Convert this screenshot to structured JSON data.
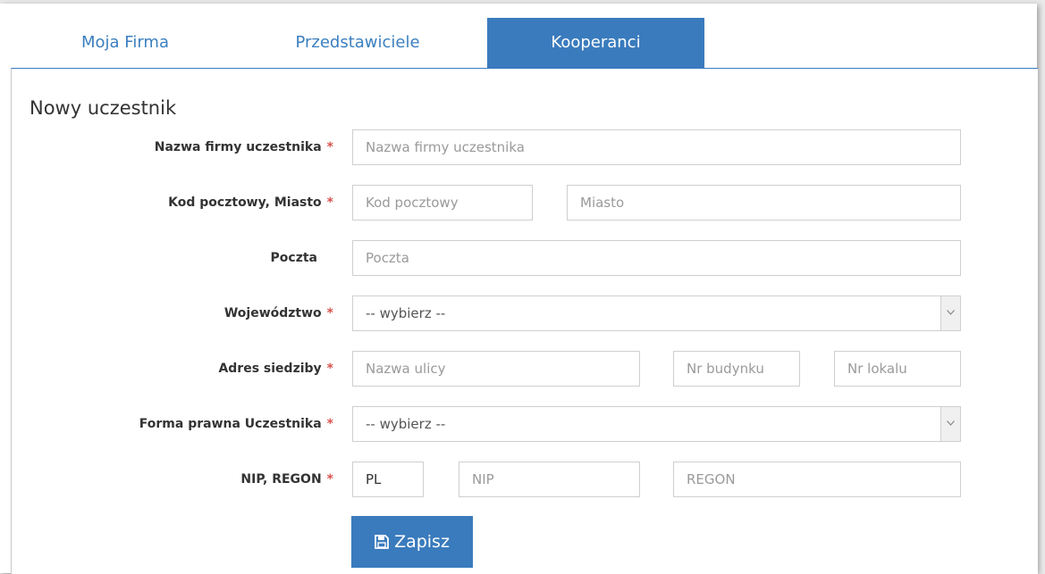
{
  "tabs": [
    {
      "label": "Moja Firma"
    },
    {
      "label": "Przedstawiciele"
    },
    {
      "label": "Kooperanci"
    }
  ],
  "form": {
    "title": "Nowy uczestnik",
    "required_mark": "*",
    "fields": {
      "company_name": {
        "label": "Nazwa firmy uczestnika",
        "placeholder": "Nazwa firmy uczestnika"
      },
      "postal_city": {
        "label": "Kod pocztowy, Miasto",
        "postal_placeholder": "Kod pocztowy",
        "city_placeholder": "Miasto"
      },
      "post_office": {
        "label": "Poczta",
        "placeholder": "Poczta"
      },
      "voivodeship": {
        "label": "Województwo",
        "selected": "-- wybierz --"
      },
      "address": {
        "label": "Adres siedziby",
        "street_placeholder": "Nazwa ulicy",
        "building_placeholder": "Nr budynku",
        "unit_placeholder": "Nr lokalu"
      },
      "legal_form": {
        "label": "Forma prawna Uczestnika",
        "selected": "-- wybierz --"
      },
      "nip_regon": {
        "label": "NIP, REGON",
        "prefix_value": "PL",
        "nip_placeholder": "NIP",
        "regon_placeholder": "REGON"
      }
    },
    "save_label": "Zapisz"
  },
  "colors": {
    "accent": "#3a7bbd",
    "required": "#d9534f",
    "tab_text": "#3b7fbf"
  },
  "icons": {
    "save": "floppy-disk-icon",
    "dropdown": "chevron-down-icon"
  }
}
